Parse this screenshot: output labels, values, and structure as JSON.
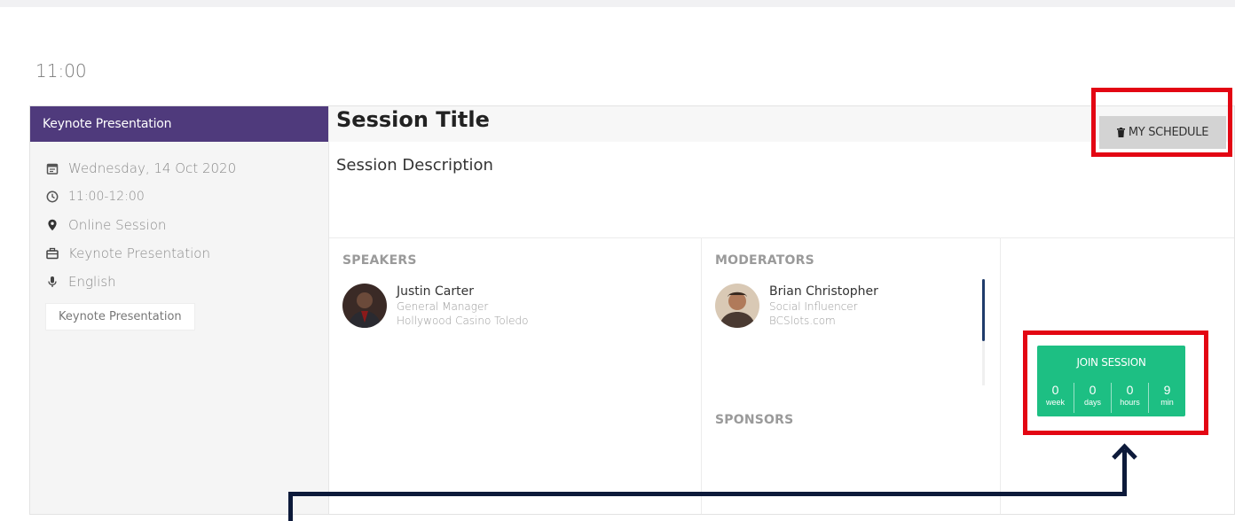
{
  "time_heading": "11:00",
  "left_panel": {
    "header": "Keynote Presentation",
    "rows": [
      {
        "icon": "calendar-icon",
        "text": "Wednesday, 14 Oct 2020"
      },
      {
        "icon": "clock-icon",
        "text": "11:00-12:00"
      },
      {
        "icon": "location-pin-icon",
        "text": "Online Session"
      },
      {
        "icon": "briefcase-icon",
        "text": "Keynote Presentation"
      },
      {
        "icon": "microphone-icon",
        "text": "English"
      }
    ],
    "tag": "Keynote Presentation"
  },
  "session": {
    "title": "Session Title",
    "description": "Session Description",
    "my_schedule_label": "MY SCHEDULE"
  },
  "speakers": {
    "label": "SPEAKERS",
    "items": [
      {
        "name": "Justin Carter",
        "role": "General Manager",
        "company": "Hollywood Casino Toledo"
      }
    ]
  },
  "moderators": {
    "label": "MODERATORS",
    "items": [
      {
        "name": "Brian Christopher",
        "role": "Social Influencer",
        "company": "BCSlots.com"
      }
    ]
  },
  "sponsors": {
    "label": "SPONSORS"
  },
  "join": {
    "label": "JOIN SESSION",
    "countdown": [
      {
        "num": "0",
        "unit": "week"
      },
      {
        "num": "0",
        "unit": "days"
      },
      {
        "num": "0",
        "unit": "hours"
      },
      {
        "num": "9",
        "unit": "min"
      }
    ]
  },
  "colors": {
    "header_purple": "#4f3a7c",
    "join_green": "#1dbf83",
    "highlight_red": "#e30613",
    "arrow_navy": "#0d1a3a",
    "schedule_gray": "#d3d3d3"
  }
}
